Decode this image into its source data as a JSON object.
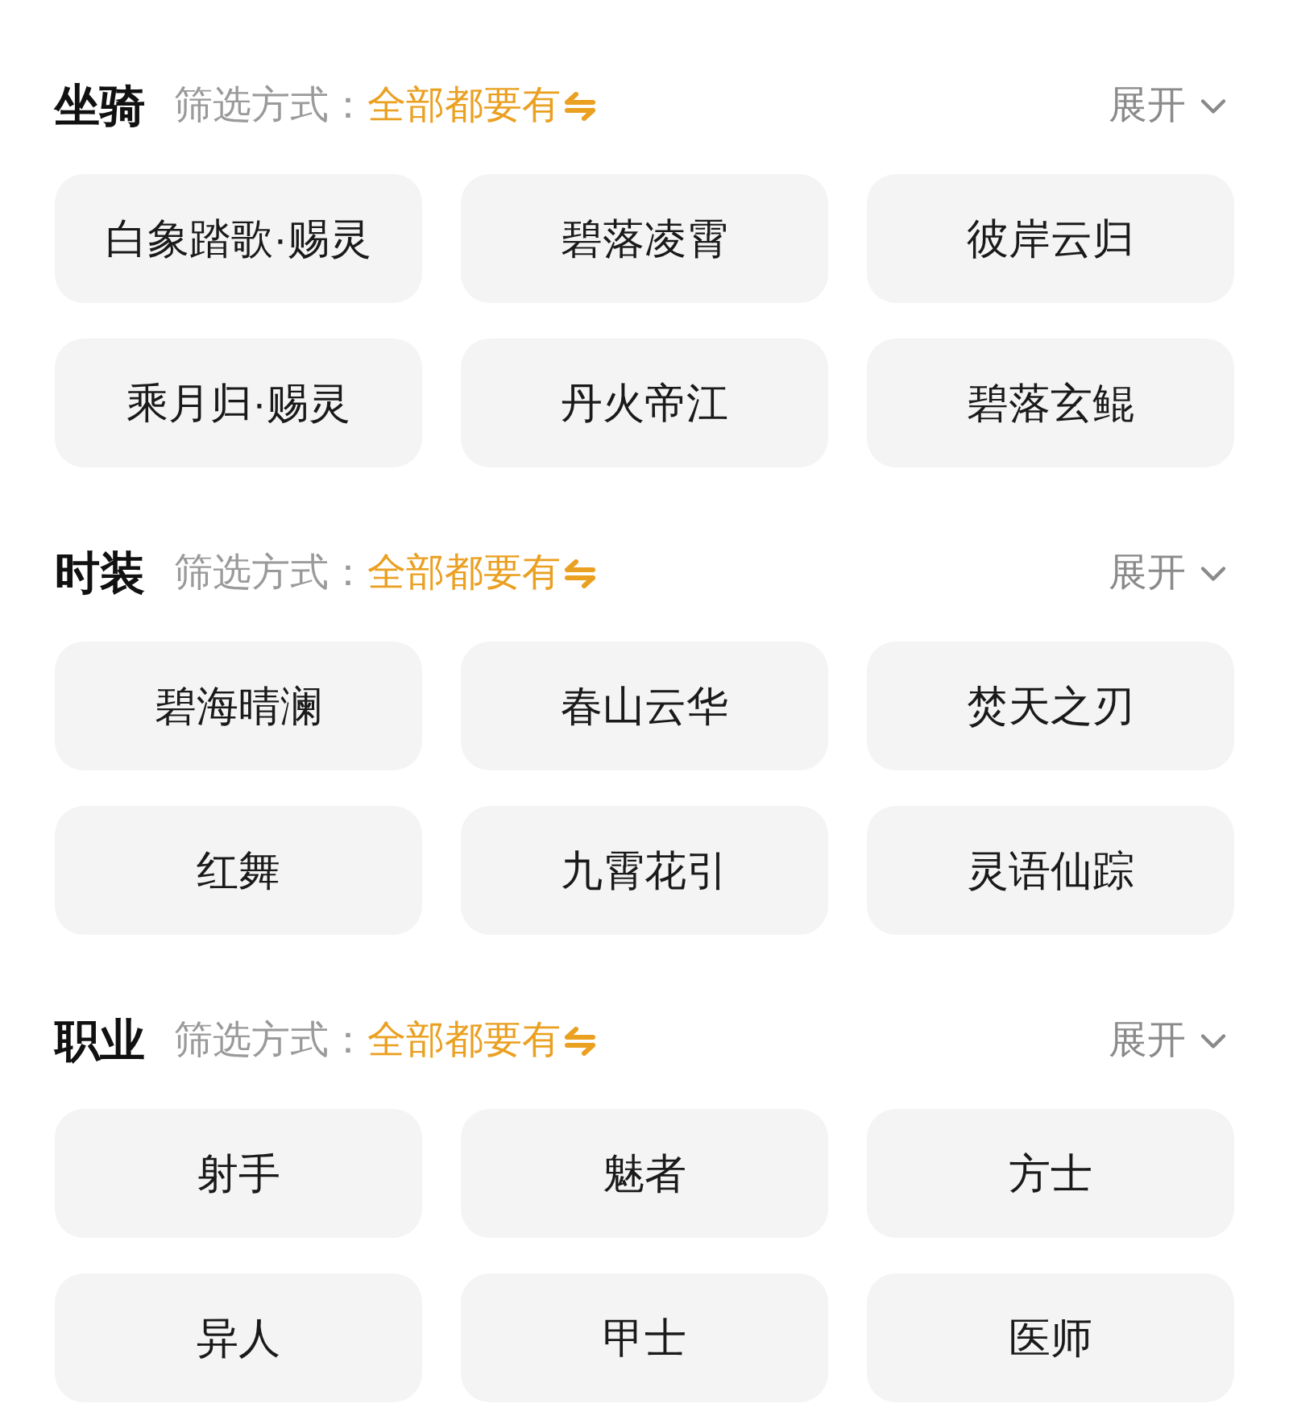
{
  "sections": [
    {
      "title": "坐骑",
      "filter_label": "筛选方式：",
      "filter_value": "全部都要有",
      "expand_label": "展开",
      "items": [
        "白象踏歌·赐灵",
        "碧落凌霄",
        "彼岸云归",
        "乘月归·赐灵",
        "丹火帝江",
        "碧落玄鲲"
      ]
    },
    {
      "title": "时装",
      "filter_label": "筛选方式：",
      "filter_value": "全部都要有",
      "expand_label": "展开",
      "items": [
        "碧海晴澜",
        "春山云华",
        "焚天之刃",
        "红舞",
        "九霄花引",
        "灵语仙踪"
      ]
    },
    {
      "title": "职业",
      "filter_label": "筛选方式：",
      "filter_value": "全部都要有",
      "expand_label": "展开",
      "items": [
        "射手",
        "魅者",
        "方士",
        "异人",
        "甲士",
        "医师"
      ]
    }
  ]
}
